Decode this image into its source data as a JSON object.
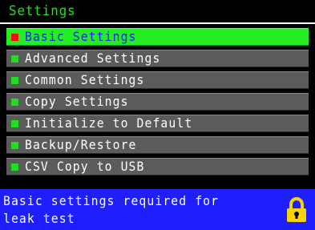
{
  "title": "Settings",
  "menu": [
    {
      "label": "Basic Settings",
      "selected": true
    },
    {
      "label": "Advanced Settings",
      "selected": false
    },
    {
      "label": "Common Settings",
      "selected": false
    },
    {
      "label": "Copy Settings",
      "selected": false
    },
    {
      "label": "Initialize to Default",
      "selected": false
    },
    {
      "label": "Backup/Restore",
      "selected": false
    },
    {
      "label": "CSV Copy to USB",
      "selected": false
    }
  ],
  "footer": {
    "description": "Basic settings required for leak test",
    "icon": "lock-icon"
  },
  "colors": {
    "title_text": "#22e022",
    "selected_bg": "#22ee22",
    "selected_text": "#1a1aff",
    "item_bg": "#5b5b5b",
    "bullet": "#22dd22",
    "selected_bullet": "#ee1111",
    "footer_bg": "#1e1eff",
    "lock": "#f7d400"
  }
}
